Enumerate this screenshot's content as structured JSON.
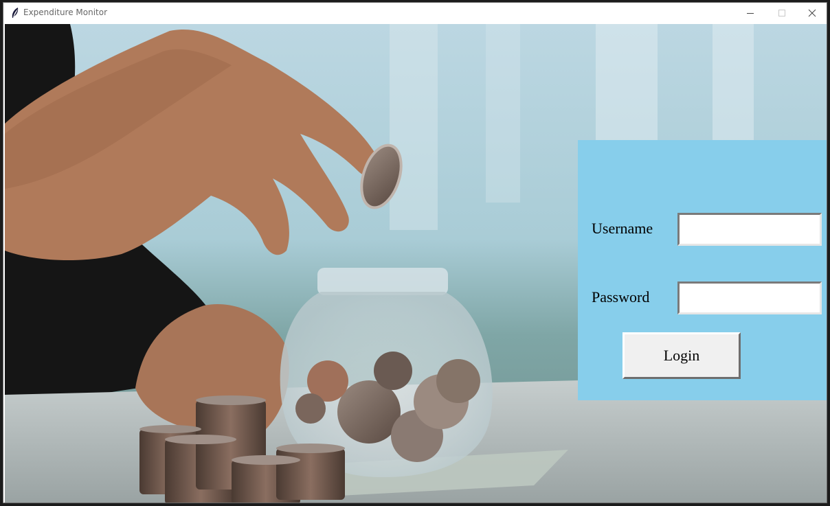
{
  "window": {
    "title": "Expenditure Monitor",
    "app_icon": "feather-icon",
    "controls": [
      "minimize-icon",
      "maximize-icon",
      "close-icon"
    ]
  },
  "background": {
    "description_icon": "coins-jar-photo"
  },
  "login_panel": {
    "bg_color": "#87ceeb",
    "username_label": "Username",
    "username_value": "",
    "password_label": "Password",
    "password_value": "",
    "login_button": "Login"
  }
}
